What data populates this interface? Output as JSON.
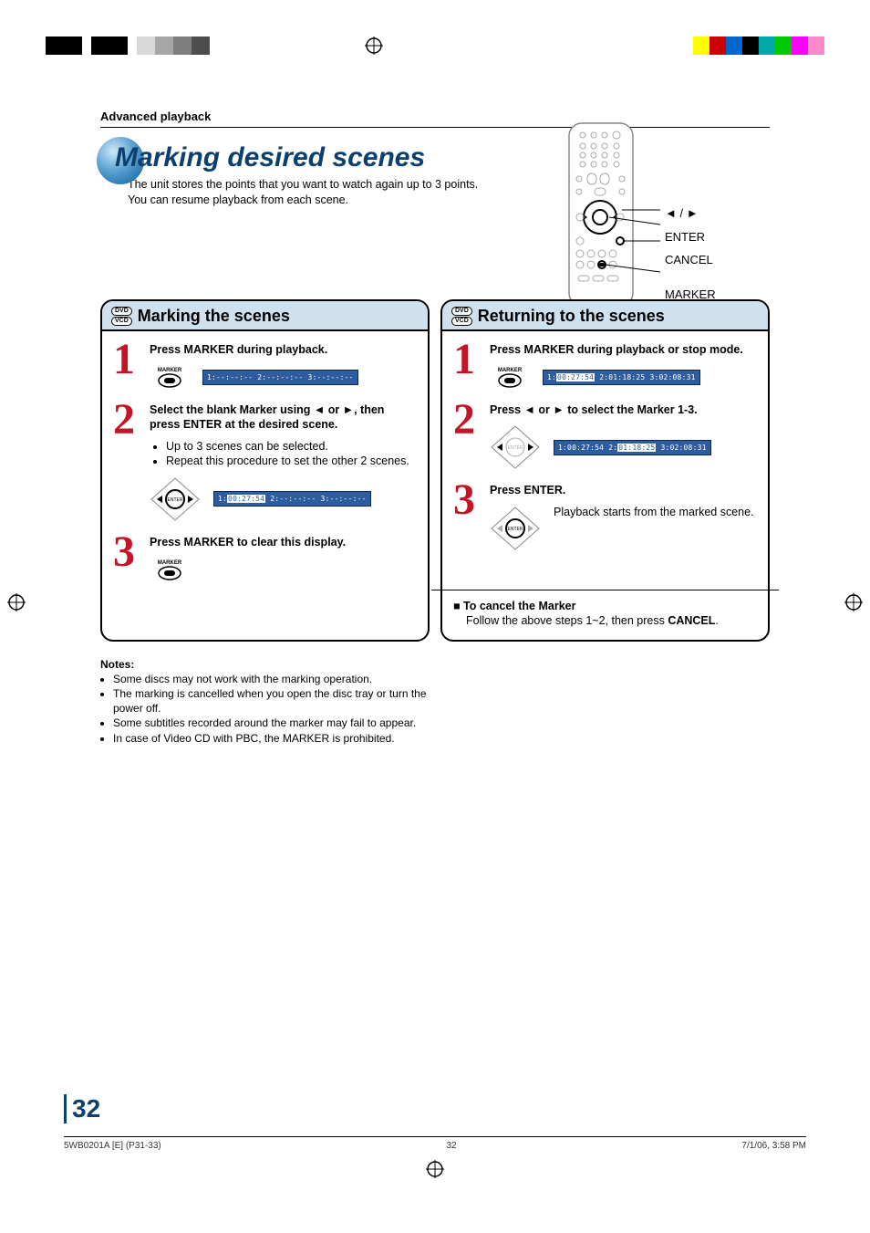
{
  "header": {
    "section": "Advanced playback"
  },
  "title": {
    "main": "Marking desired scenes",
    "desc1": "The unit stores the points that you want to watch again up to 3 points.",
    "desc2": "You can resume playback from each scene."
  },
  "remote": {
    "nav": "◄ / ►",
    "enter": "ENTER",
    "cancel": "CANCEL",
    "marker": "MARKER"
  },
  "disc": {
    "dvd": "DVD",
    "vcd": "VCD"
  },
  "left_panel": {
    "title": "Marking the scenes",
    "steps": {
      "s1": {
        "num": "1",
        "title": "Press MARKER during playback.",
        "btn_label": "MARKER",
        "osd": {
          "m1": "1:",
          "v1": "--:--:--",
          "m2": " 2:",
          "v2": "--:--:--",
          "m3": " 3:",
          "v3": "--:--:--"
        }
      },
      "s2": {
        "num": "2",
        "title": "Select the blank Marker using ◄ or ►, then press ENTER at the desired scene.",
        "b1": "Up to 3 scenes can be selected.",
        "b2": "Repeat this procedure to set the other 2 scenes.",
        "osd": {
          "m1": "1:",
          "v1": "00:27:54",
          "m2": " 2:",
          "v2": "--:--:--",
          "m3": " 3:",
          "v3": "--:--:--"
        }
      },
      "s3": {
        "num": "3",
        "title": "Press MARKER to clear this display.",
        "btn_label": "MARKER"
      }
    }
  },
  "right_panel": {
    "title": "Returning to the scenes",
    "steps": {
      "s1": {
        "num": "1",
        "title": "Press MARKER during playback or stop mode.",
        "btn_label": "MARKER",
        "osd": {
          "m1": "1:",
          "v1": "00:27:54",
          "m2": " 2:",
          "v2": "01:18:25",
          "m3": " 3:",
          "v3": "02:08:31"
        }
      },
      "s2": {
        "num": "2",
        "title": "Press ◄ or ► to select the Marker 1-3.",
        "osd": {
          "m1": "1:",
          "v1": "00:27:54",
          "m2": " 2:",
          "v2": "01:18:25",
          "m3": " 3:",
          "v3": "02:08:31",
          "hl": 1
        }
      },
      "s3": {
        "num": "3",
        "title": "Press ENTER.",
        "desc": "Playback starts from the marked scene."
      }
    },
    "cancel_title": "To cancel the Marker",
    "cancel_body_pre": "Follow the above steps 1~2, then press ",
    "cancel_body_bold": "CANCEL",
    "cancel_body_post": "."
  },
  "notes": {
    "title": "Notes:",
    "items": [
      "Some discs may not work with the marking operation.",
      "The marking is cancelled when you open the disc tray or turn the power off.",
      "Some subtitles recorded around the marker may fail to appear.",
      "In case of Video CD with PBC, the MARKER is prohibited."
    ]
  },
  "footer": {
    "page_num": "32",
    "left": "5WB0201A [E] (P31-33)",
    "center": "32",
    "right": "7/1/06, 3:58 PM"
  }
}
